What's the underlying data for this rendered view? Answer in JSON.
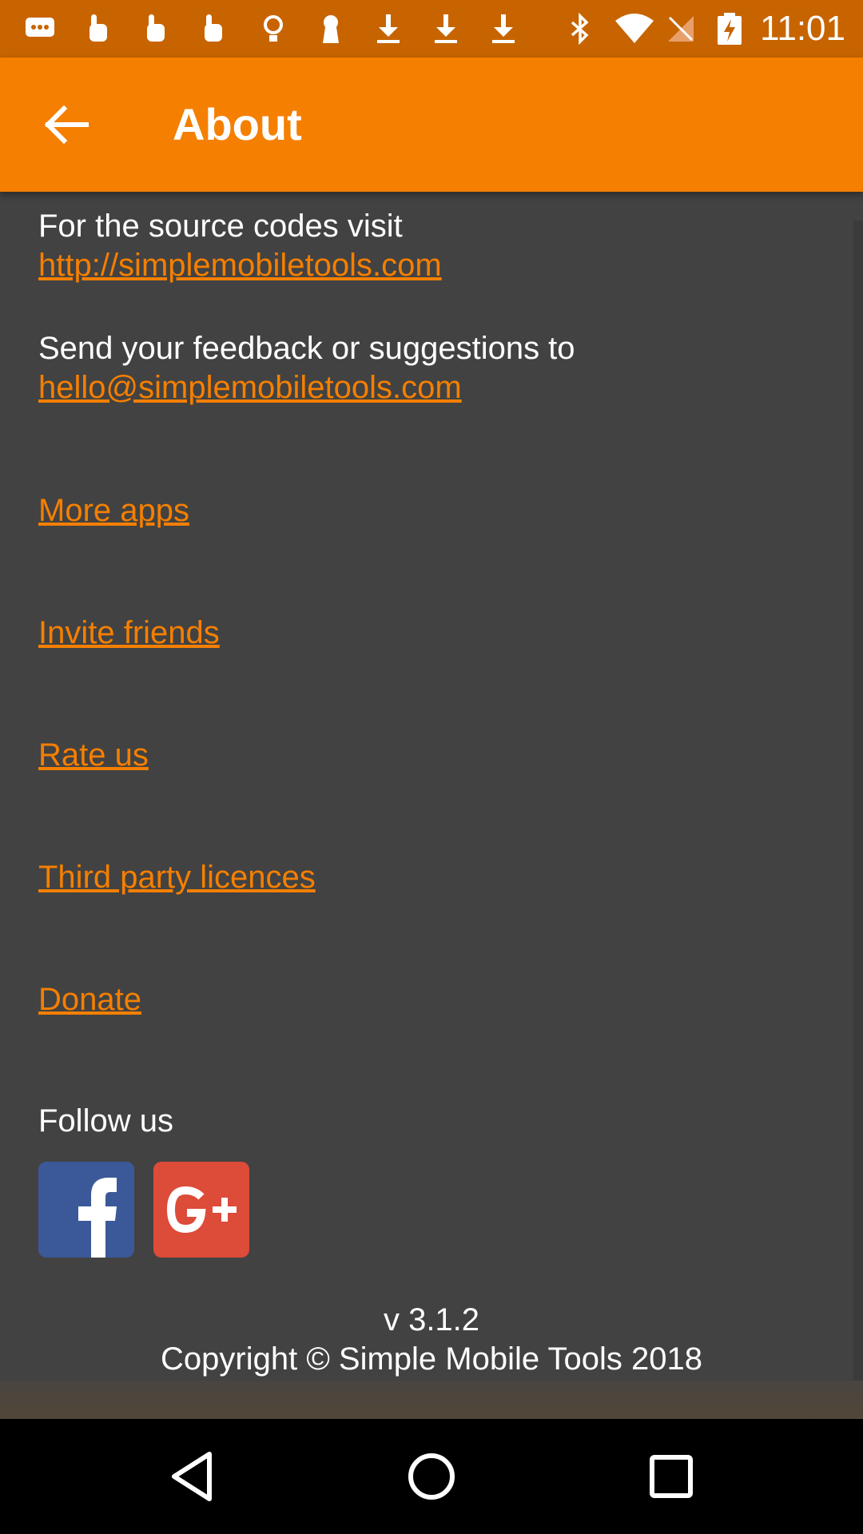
{
  "status_bar": {
    "time": "11:01",
    "icons": [
      "message-icon",
      "touch-icon",
      "touch-icon",
      "touch-icon",
      "lightbulb-icon",
      "keyhole-icon",
      "download-icon",
      "download-icon",
      "download-icon",
      "bluetooth-icon",
      "wifi-icon",
      "no-signal-icon",
      "battery-charging-icon"
    ]
  },
  "app_bar": {
    "title": "About",
    "back_icon": "arrow-back-icon"
  },
  "about": {
    "source_text": "For the source codes visit",
    "source_link": "http://simplemobiletools.com",
    "feedback_text": "Send your feedback or suggestions to",
    "feedback_link": "hello@simplemobiletools.com",
    "more_apps": "More apps",
    "invite_friends": "Invite friends",
    "rate_us": "Rate us",
    "third_party": "Third party licences",
    "donate": "Donate",
    "follow_us": "Follow us",
    "social": {
      "facebook_icon": "facebook-icon",
      "google_plus_icon": "google-plus-icon"
    },
    "version": "v 3.1.2",
    "copyright": "Copyright © Simple Mobile Tools 2018"
  },
  "nav_bar": {
    "back": "nav-back-icon",
    "home": "nav-home-icon",
    "recents": "nav-recents-icon"
  },
  "colors": {
    "accent": "#F57F00",
    "status_bar": "#C76400",
    "background": "#424242",
    "facebook": "#3B5998",
    "google_plus": "#DD4B39"
  }
}
